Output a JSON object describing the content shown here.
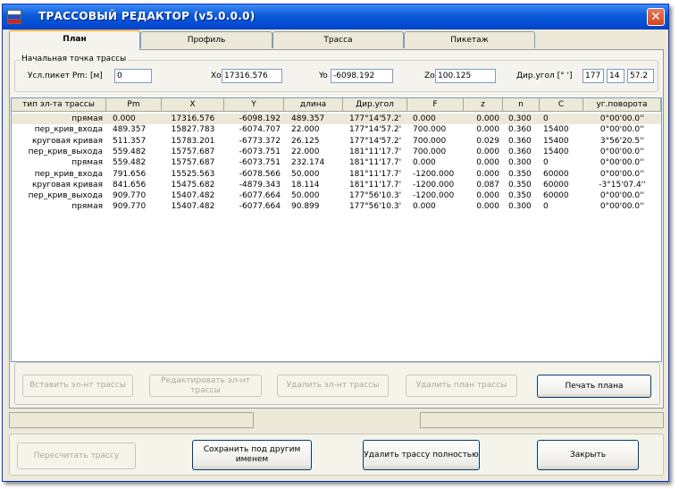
{
  "window": {
    "title": "ТРАССОВЫЙ РЕДАКТОР (v5.0.0.0)",
    "close_glyph": "✕"
  },
  "tabs": [
    {
      "label": "План"
    },
    {
      "label": "Профиль"
    },
    {
      "label": "Трасса"
    },
    {
      "label": "Пикетаж"
    }
  ],
  "start_point": {
    "legend": "Начальная точка трассы",
    "pm_label": "Усл.пикет Pm: [м]",
    "pm_value": "0",
    "xo_label": "Xo",
    "xo_value": "17316.576",
    "yo_label": "Yo",
    "yo_value": "-6098.192",
    "zo_label": "Zo",
    "zo_value": "100.125",
    "angle_label": "Дир.угол [° ']",
    "angle_deg": "177",
    "angle_min": "14",
    "angle_sec": "57.2"
  },
  "table": {
    "headers": [
      "тип эл-та трассы",
      "Pm",
      "X",
      "Y",
      "длина",
      "Дир.угол",
      "F",
      "z",
      "n",
      "C",
      "уг.поворота"
    ],
    "rows": [
      [
        "прямая",
        "0.000",
        "17316.576",
        "-6098.192",
        "489.357",
        "177°14'57.2'",
        "0.000",
        "0.000",
        "0.300",
        "0",
        "0°00'00.0''"
      ],
      [
        "пер_крив_входа",
        "489.357",
        "15827.783",
        "-6074.707",
        "22.000",
        "177°14'57.2'",
        "700.000",
        "0.000",
        "0.360",
        "15400",
        "0°00'00.0''"
      ],
      [
        "круговая кривая",
        "511.357",
        "15783.201",
        "-6773.372",
        "26.125",
        "177°14'57.2'",
        "700.000",
        "0.029",
        "0.360",
        "15400",
        "3°56'20.5''"
      ],
      [
        "пер_крив_выхода",
        "559.482",
        "15757.687",
        "-6073.751",
        "22.000",
        "181°11'17.7'",
        "700.000",
        "0.000",
        "0.360",
        "15400",
        "0°00'00.0''"
      ],
      [
        "прямая",
        "559.482",
        "15757.687",
        "-6073.751",
        "232.174",
        "181°11'17.7'",
        "0.000",
        "0.000",
        "0.300",
        "0",
        "0°00'00.0''"
      ],
      [
        "пер_крив_входа",
        "791.656",
        "15525.563",
        "-6078.566",
        "50.000",
        "181°11'17.7'",
        "-1200.000",
        "0.000",
        "0.350",
        "60000",
        "0°00'00.0''"
      ],
      [
        "круговая кривая",
        "841.656",
        "15475.682",
        "-4879.343",
        "18.114",
        "181°11'17.7'",
        "-1200.000",
        "0.087",
        "0.350",
        "60000",
        "-3°15'07.4''"
      ],
      [
        "пер_крив_выхода",
        "909.770",
        "15407.482",
        "-6077.664",
        "50.000",
        "177°56'10.3'",
        "-1200.000",
        "0.000",
        "0.350",
        "60000",
        "0°00'00.0''"
      ],
      [
        "прямая",
        "909.770",
        "15407.482",
        "-6077.664",
        "90.899",
        "177°56'10.3'",
        "0.000",
        "0.000",
        "0.300",
        "0",
        "0°00'00.0''"
      ]
    ]
  },
  "plan_buttons": {
    "insert": "Вставить эл-нт трассы",
    "edit": "Редактировать эл-нт трассы",
    "delete_el": "Удалить эл-нт трассы",
    "delete_plan": "Удалить план трассы",
    "print": "Печать плана"
  },
  "bottom_buttons": {
    "recalc": "Пересчитать трассу",
    "save_as": "Сохранить под другим именем",
    "delete_route": "Удалить трассу полностью",
    "close": "Закрыть"
  }
}
